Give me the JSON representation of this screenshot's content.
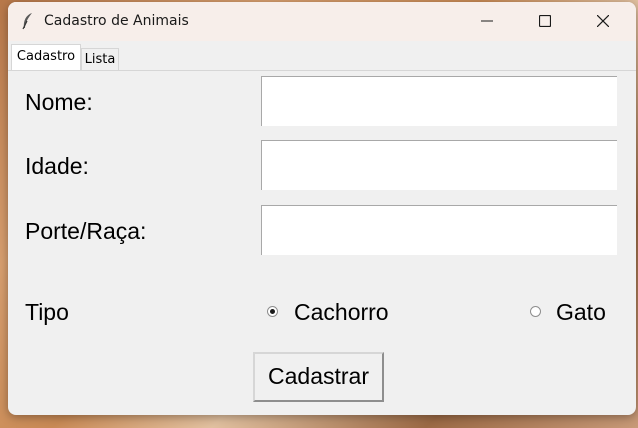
{
  "window": {
    "title": "Cadastro de Animais",
    "icon": "feather-icon"
  },
  "tabs": [
    {
      "label": "Cadastro",
      "selected": true
    },
    {
      "label": "Lista",
      "selected": false
    }
  ],
  "form": {
    "nome_label": "Nome:",
    "idade_label": "Idade:",
    "porte_label": "Porte/Raça:",
    "nome_value": "",
    "idade_value": "",
    "porte_value": "",
    "tipo_label": "Tipo",
    "options": [
      {
        "label": "Cachorro",
        "selected": true
      },
      {
        "label": "Gato",
        "selected": false
      }
    ],
    "submit_label": "Cadastrar"
  }
}
